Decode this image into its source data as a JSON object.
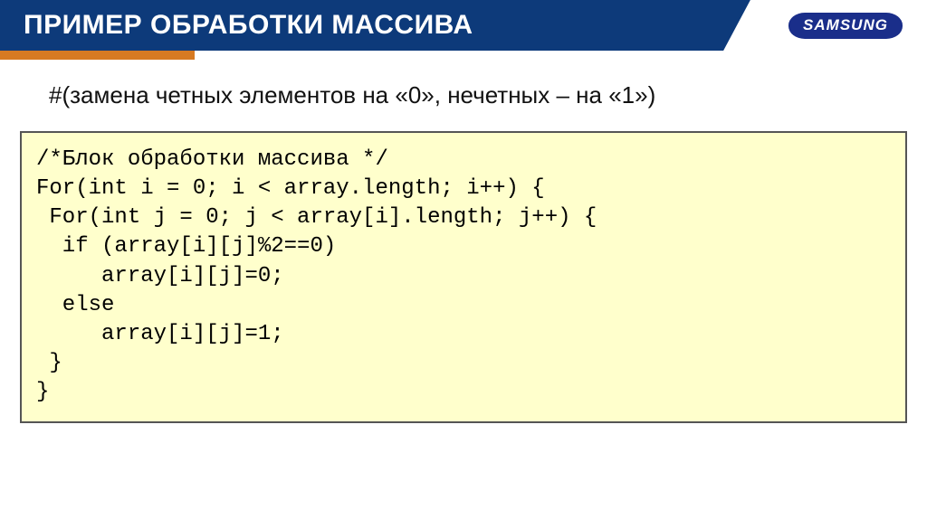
{
  "header": {
    "title": "ПРИМЕР ОБРАБОТКИ МАССИВА",
    "logo_text": "SAMSUNG"
  },
  "subtitle": "#(замена четных элементов на «0», нечетных – на «1»)",
  "code": {
    "lines": [
      "/*Блок обработки массива */",
      "For(int i = 0; i < array.length; i++) {",
      " For(int j = 0; j < array[i].length; j++) {",
      "  if (array[i][j]%2==0)",
      "     array[i][j]=0;",
      "  else",
      "     array[i][j]=1;",
      " }",
      "}"
    ]
  },
  "colors": {
    "header_bg": "#0d3a7a",
    "accent_orange": "#d77a22",
    "code_bg": "#ffffcc",
    "code_border": "#555555",
    "logo_bg": "#1a2e8a"
  }
}
